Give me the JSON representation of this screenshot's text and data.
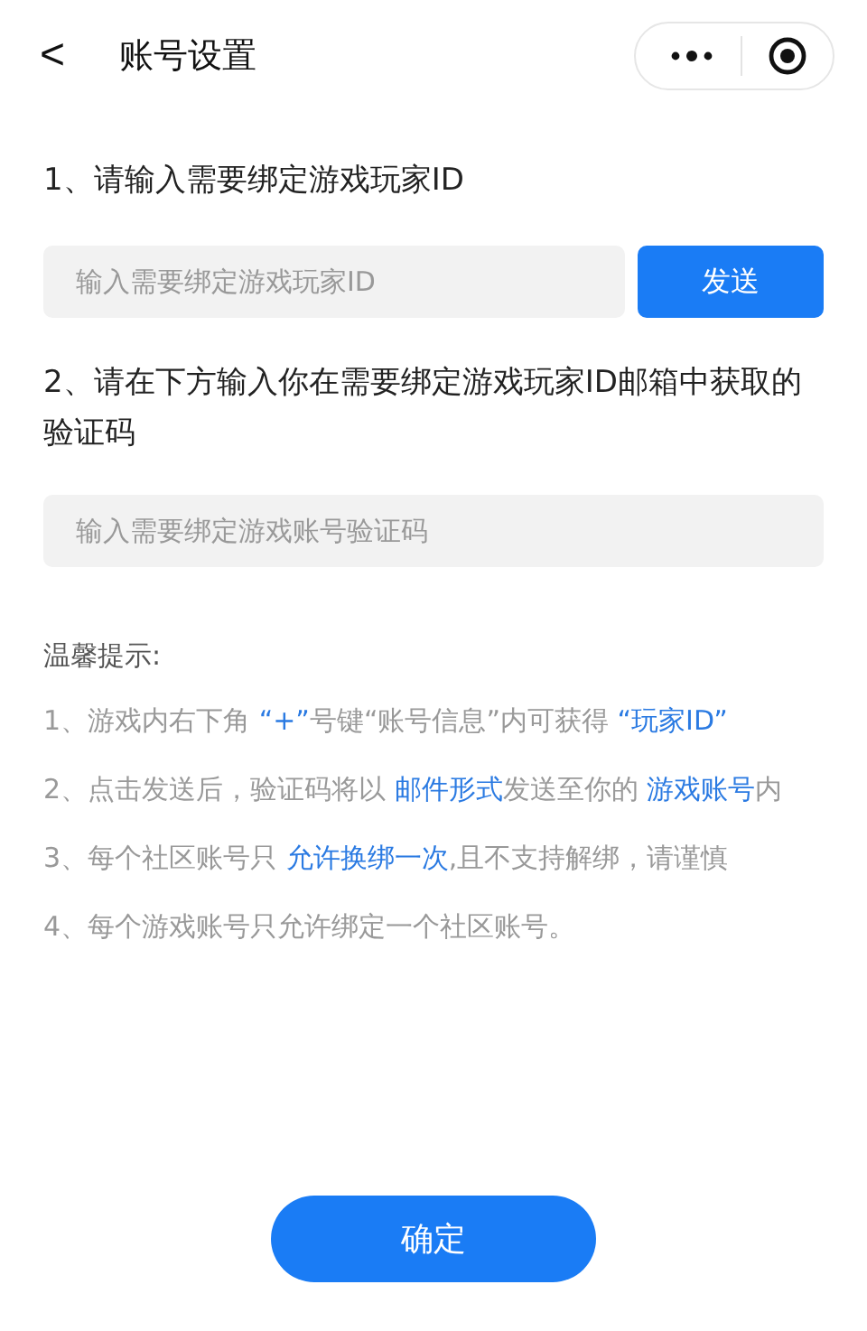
{
  "header": {
    "back": "<",
    "title": "账号设置"
  },
  "step1": {
    "label": "1、请输入需要绑定游戏玩家ID",
    "input": {
      "placeholder": "输入需要绑定游戏玩家ID"
    },
    "button": "发送"
  },
  "step2": {
    "label": "2、请在下方输入你在需要绑定游戏玩家ID邮箱中获取的验证码",
    "input": {
      "placeholder": "输入需要绑定游戏账号验证码"
    }
  },
  "tips": {
    "title": "温馨提示:",
    "items": [
      [
        {
          "text": "1、游戏内右下角 ",
          "highlight": false
        },
        {
          "text": "“+”",
          "highlight": true
        },
        {
          "text": "号键“账号信息”内可获得 ",
          "highlight": false
        },
        {
          "text": "“玩家ID”",
          "highlight": true
        }
      ],
      [
        {
          "text": "2、点击发送后，验证码将以 ",
          "highlight": false
        },
        {
          "text": "邮件形式",
          "highlight": true
        },
        {
          "text": "发送至你的 ",
          "highlight": false
        },
        {
          "text": "游戏账号",
          "highlight": true
        },
        {
          "text": "内",
          "highlight": false
        }
      ],
      [
        {
          "text": "3、每个社区账号只 ",
          "highlight": false
        },
        {
          "text": "允许换绑一次",
          "highlight": true
        },
        {
          "text": ",且不支持解绑，请谨慎",
          "highlight": false
        }
      ],
      [
        {
          "text": "4、每个游戏账号只允许绑定一个社区账号。",
          "highlight": false
        }
      ]
    ]
  },
  "confirm": "确定"
}
